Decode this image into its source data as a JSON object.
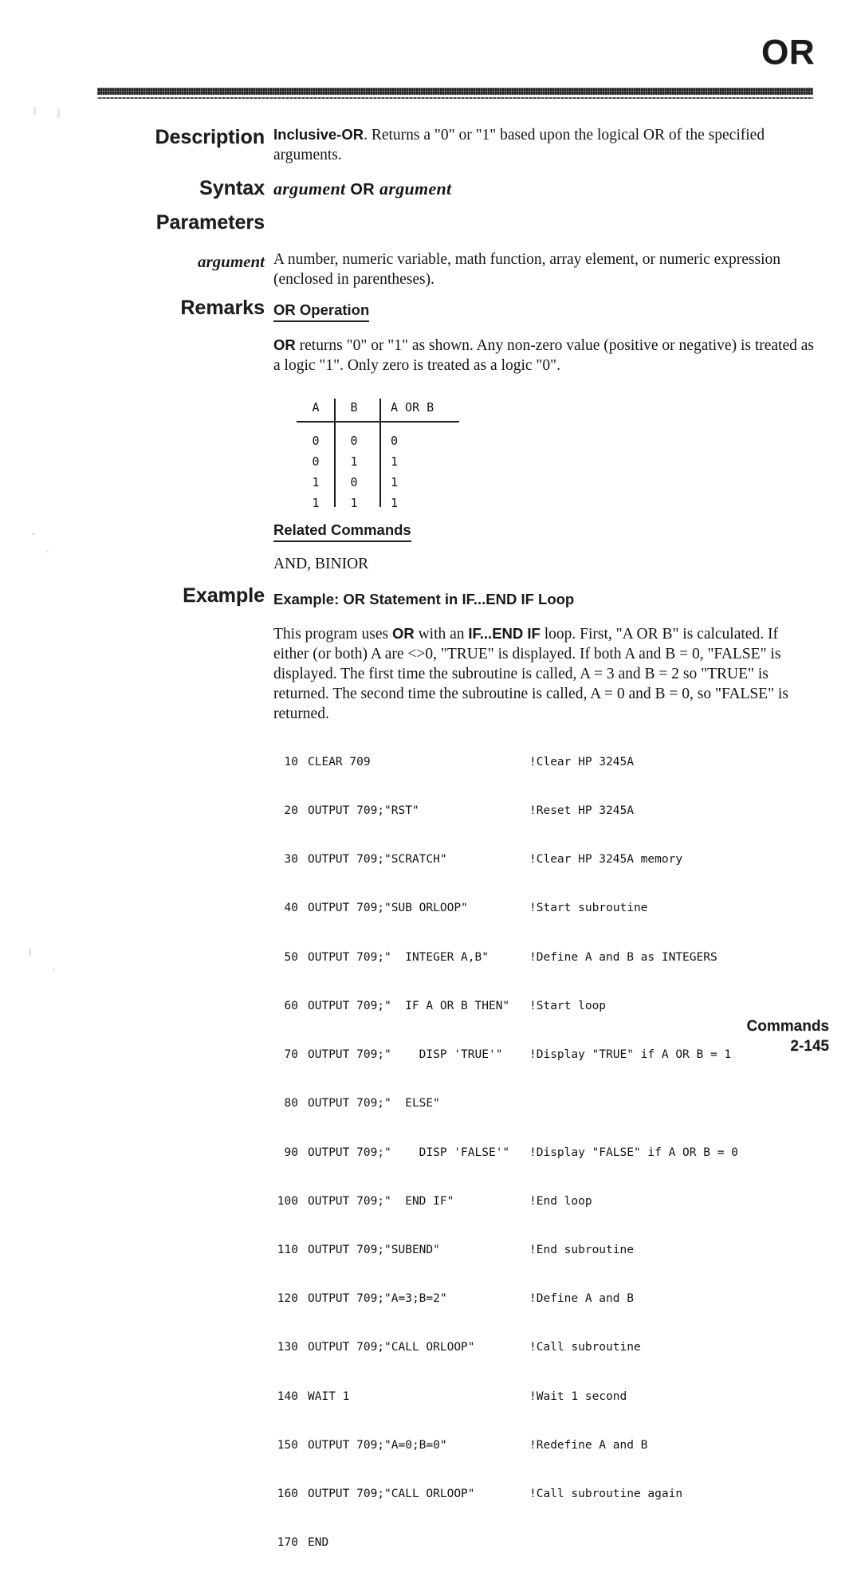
{
  "header": {
    "command_title": "OR"
  },
  "sections": {
    "description": {
      "label": "Description",
      "lead": "Inclusive-OR",
      "text": ". Returns a \"0\" or \"1\" based upon the logical OR of the specified arguments."
    },
    "syntax": {
      "label": "Syntax",
      "arg_left": "argument",
      "operator": "OR",
      "arg_right": "argument"
    },
    "parameters": {
      "label": "Parameters",
      "arg_label": "argument",
      "arg_text": "A number, numeric variable, math function, array element, or numeric expression (enclosed in parentheses)."
    },
    "remarks": {
      "label": "Remarks",
      "operation_heading": "OR Operation",
      "operation_bold": "OR",
      "operation_text": " returns \"0\" or \"1\" as shown.  Any non-zero value (positive or negative) is treated as a logic \"1\".  Only zero is treated as a logic \"0\".",
      "related_heading": "Related Commands",
      "related_commands": "AND, BINIOR"
    },
    "example": {
      "label": "Example",
      "heading": "Example: OR Statement in IF...END IF Loop",
      "paragraph_1": "This program uses ",
      "paragraph_b1": "OR",
      "paragraph_2": " with an ",
      "paragraph_b2": "IF...END IF",
      "paragraph_3": " loop.  First, \"A OR B\" is calculated.  If either (or both) A are <>0, \"TRUE\" is displayed.  If both A and B = 0, \"FALSE\" is displayed.  The first time the subroutine is called, A = 3 and B = 2 so \"TRUE\" is returned.  The second time the subroutine is called, A = 0 and B = 0, so \"FALSE\" is returned."
    }
  },
  "truth_table": {
    "headers": [
      "A",
      "B",
      "A OR B"
    ],
    "rows": [
      [
        "0",
        "0",
        "0"
      ],
      [
        "0",
        "1",
        "1"
      ],
      [
        "1",
        "0",
        "1"
      ],
      [
        "1",
        "1",
        "1"
      ]
    ]
  },
  "code_listing": [
    {
      "num": "10",
      "stmt": "CLEAR 709",
      "comment": "!Clear HP 3245A"
    },
    {
      "num": "20",
      "stmt": "OUTPUT 709;\"RST\"",
      "comment": "!Reset HP 3245A"
    },
    {
      "num": "30",
      "stmt": "OUTPUT 709;\"SCRATCH\"",
      "comment": "!Clear HP 3245A memory"
    },
    {
      "num": "40",
      "stmt": "OUTPUT 709;\"SUB ORLOOP\"",
      "comment": "!Start subroutine"
    },
    {
      "num": "50",
      "stmt": "OUTPUT 709;\"  INTEGER A,B\"",
      "comment": "!Define A and B as INTEGERS"
    },
    {
      "num": "60",
      "stmt": "OUTPUT 709;\"  IF A OR B THEN\"",
      "comment": "!Start loop"
    },
    {
      "num": "70",
      "stmt": "OUTPUT 709;\"    DISP 'TRUE'\"",
      "comment": "!Display \"TRUE\" if A OR B = 1"
    },
    {
      "num": "80",
      "stmt": "OUTPUT 709;\"  ELSE\"",
      "comment": ""
    },
    {
      "num": "90",
      "stmt": "OUTPUT 709;\"    DISP 'FALSE'\"",
      "comment": "!Display \"FALSE\" if A OR B = 0"
    },
    {
      "num": "100",
      "stmt": "OUTPUT 709;\"  END IF\"",
      "comment": "!End loop"
    },
    {
      "num": "110",
      "stmt": "OUTPUT 709;\"SUBEND\"",
      "comment": "!End subroutine"
    },
    {
      "num": "120",
      "stmt": "OUTPUT 709;\"A=3;B=2\"",
      "comment": "!Define A and B"
    },
    {
      "num": "130",
      "stmt": "OUTPUT 709;\"CALL ORLOOP\"",
      "comment": "!Call subroutine"
    },
    {
      "num": "140",
      "stmt": "WAIT 1",
      "comment": "!Wait 1 second"
    },
    {
      "num": "150",
      "stmt": "OUTPUT 709;\"A=0;B=0\"",
      "comment": "!Redefine A and B"
    },
    {
      "num": "160",
      "stmt": "OUTPUT 709;\"CALL ORLOOP\"",
      "comment": "!Call subroutine again"
    },
    {
      "num": "170",
      "stmt": "END",
      "comment": ""
    }
  ],
  "footer": {
    "chapter": "Commands",
    "page_number": "2-145"
  }
}
